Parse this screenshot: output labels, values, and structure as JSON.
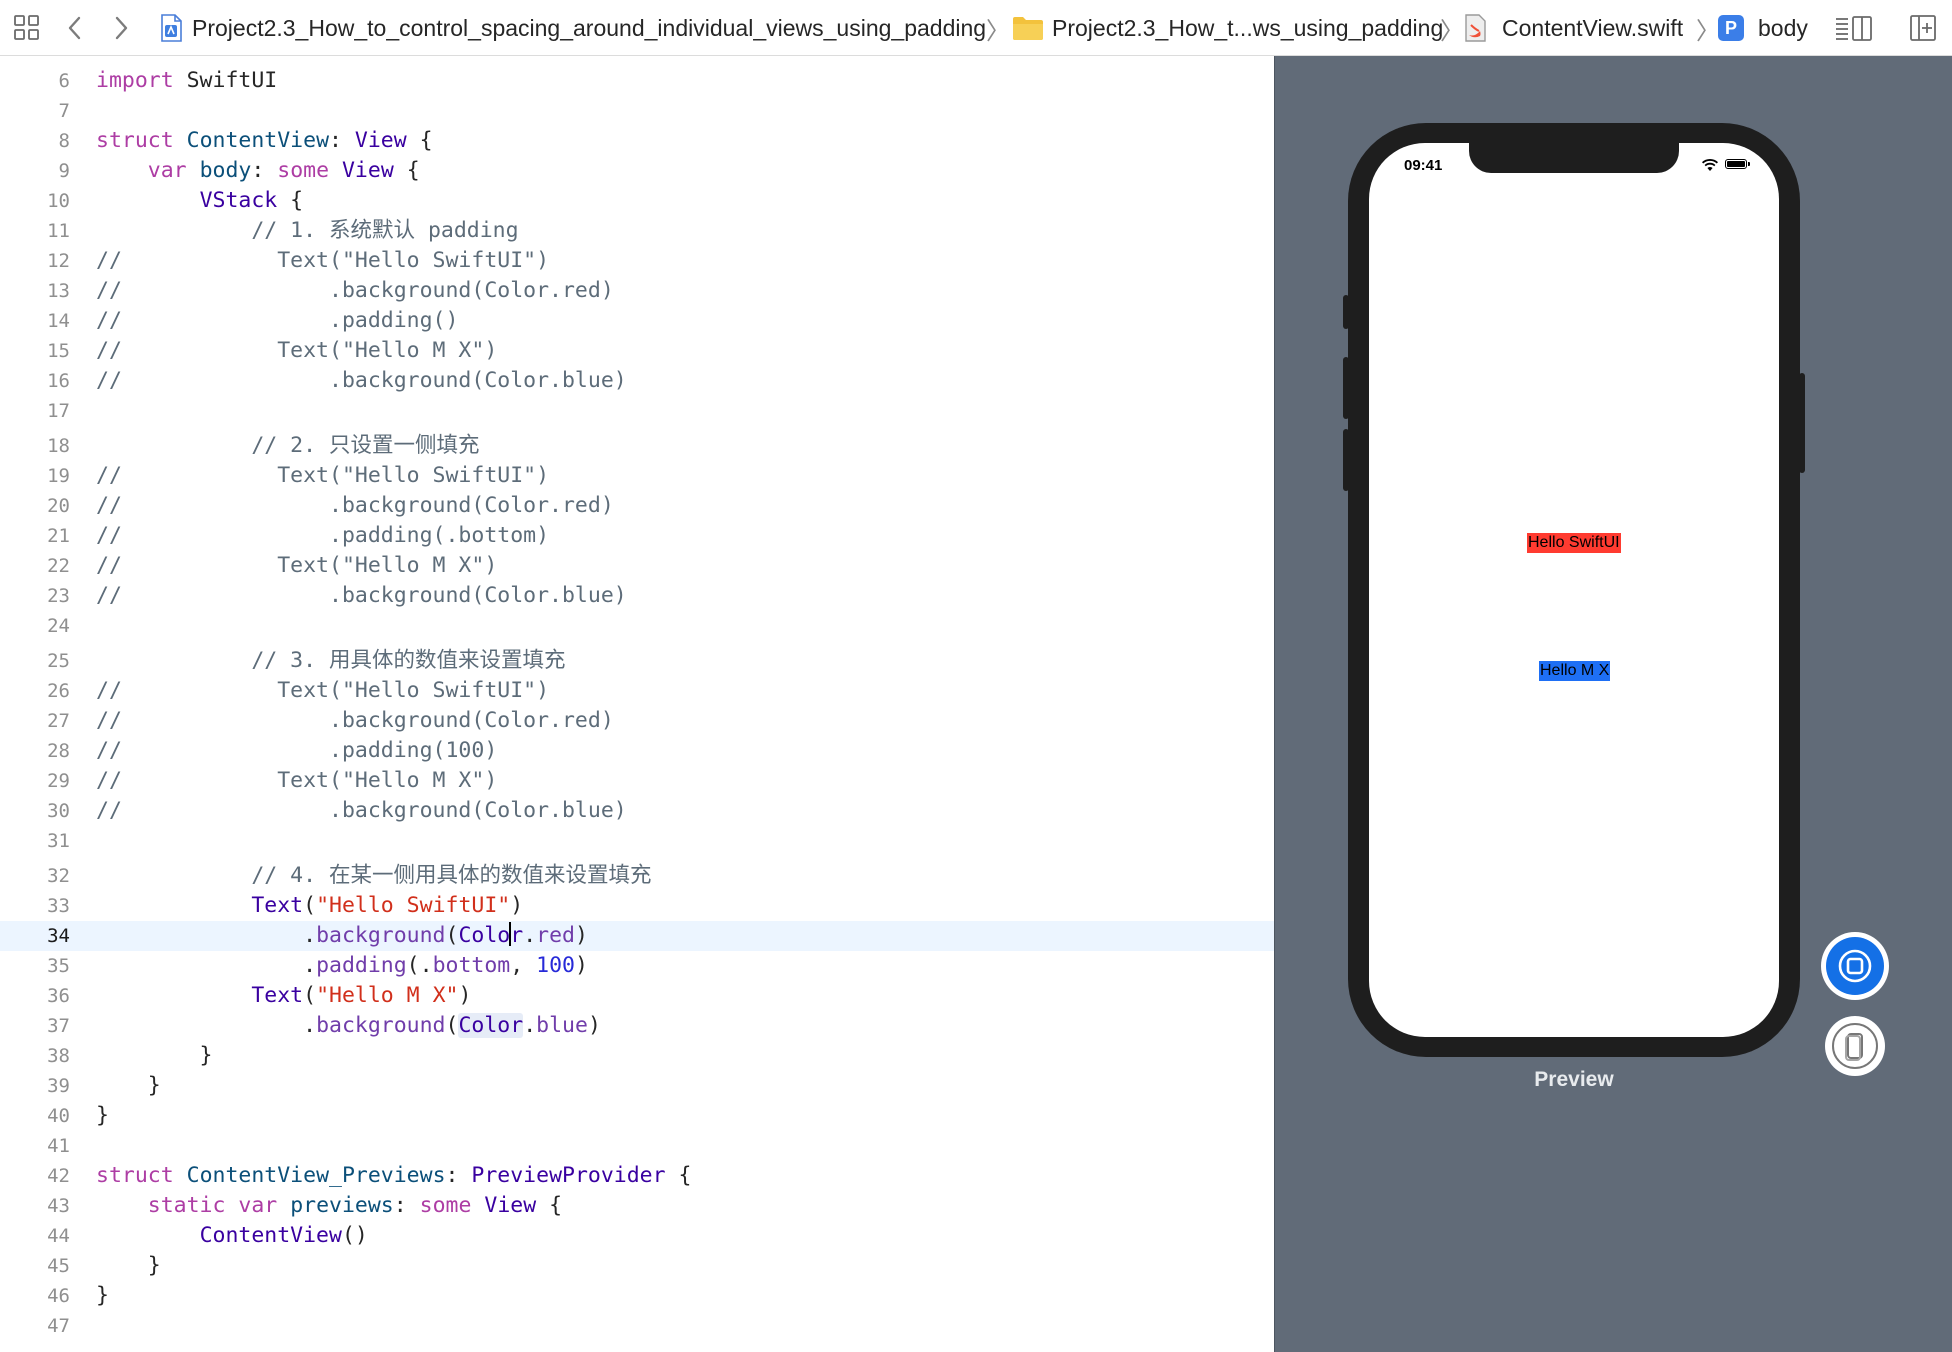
{
  "jumpbar": {
    "breadcrumbs": [
      {
        "label": "Project2.3_How_to_control_spacing_around_individual_views_using_padding",
        "icon": "xcode-project-icon"
      },
      {
        "label": "Project2.3_How_t...ws_using_padding",
        "icon": "folder-icon"
      },
      {
        "label": "ContentView.swift",
        "icon": "swift-file-icon"
      },
      {
        "label": "body",
        "icon": "property-icon",
        "badge": "P"
      }
    ],
    "icons": [
      "grid-icon",
      "back-arrow-icon",
      "forward-arrow-icon",
      "editor-options-icon",
      "add-editor-icon"
    ],
    "separator": "〉"
  },
  "editor": {
    "current_line": 34,
    "lines": [
      {
        "n": "6",
        "text": "import SwiftUI"
      },
      {
        "n": "7",
        "text": ""
      },
      {
        "n": "8",
        "text": "struct ContentView: View {"
      },
      {
        "n": "9",
        "text": "    var body: some View {"
      },
      {
        "n": "10",
        "text": "        VStack {"
      },
      {
        "n": "11",
        "text": "            // 1. 系统默认 padding"
      },
      {
        "n": "12",
        "text": "//            Text(\"Hello SwiftUI\")"
      },
      {
        "n": "13",
        "text": "//                .background(Color.red)"
      },
      {
        "n": "14",
        "text": "//                .padding()"
      },
      {
        "n": "15",
        "text": "//            Text(\"Hello M X\")"
      },
      {
        "n": "16",
        "text": "//                .background(Color.blue)"
      },
      {
        "n": "17",
        "text": ""
      },
      {
        "n": "18",
        "text": "            // 2. 只设置一侧填充"
      },
      {
        "n": "19",
        "text": "//            Text(\"Hello SwiftUI\")"
      },
      {
        "n": "20",
        "text": "//                .background(Color.red)"
      },
      {
        "n": "21",
        "text": "//                .padding(.bottom)"
      },
      {
        "n": "22",
        "text": "//            Text(\"Hello M X\")"
      },
      {
        "n": "23",
        "text": "//                .background(Color.blue)"
      },
      {
        "n": "24",
        "text": ""
      },
      {
        "n": "25",
        "text": "            // 3. 用具体的数值来设置填充"
      },
      {
        "n": "26",
        "text": "//            Text(\"Hello SwiftUI\")"
      },
      {
        "n": "27",
        "text": "//                .background(Color.red)"
      },
      {
        "n": "28",
        "text": "//                .padding(100)"
      },
      {
        "n": "29",
        "text": "//            Text(\"Hello M X\")"
      },
      {
        "n": "30",
        "text": "//                .background(Color.blue)"
      },
      {
        "n": "31",
        "text": ""
      },
      {
        "n": "32",
        "text": "            // 4. 在某一侧用具体的数值来设置填充"
      },
      {
        "n": "33",
        "text": "            Text(\"Hello SwiftUI\")"
      },
      {
        "n": "34",
        "text": "                .background(Color.red)"
      },
      {
        "n": "35",
        "text": "                .padding(.bottom, 100)"
      },
      {
        "n": "36",
        "text": "            Text(\"Hello M X\")"
      },
      {
        "n": "37",
        "text": "                .background(Color.blue)"
      },
      {
        "n": "38",
        "text": "        }"
      },
      {
        "n": "39",
        "text": "    }"
      },
      {
        "n": "40",
        "text": "}"
      },
      {
        "n": "41",
        "text": ""
      },
      {
        "n": "42",
        "text": "struct ContentView_Previews: PreviewProvider {"
      },
      {
        "n": "43",
        "text": "    static var previews: some View {"
      },
      {
        "n": "44",
        "text": "        ContentView()"
      },
      {
        "n": "45",
        "text": "    }"
      },
      {
        "n": "46",
        "text": "}"
      },
      {
        "n": "47",
        "text": ""
      }
    ]
  },
  "preview": {
    "label": "Preview",
    "status_time": "09:41",
    "texts": [
      {
        "label": "Hello SwiftUI",
        "background": "#ff3b30"
      },
      {
        "label": "Hello M X",
        "background": "#1e6ff5"
      }
    ],
    "buttons": [
      "live-preview-icon",
      "preview-on-device-icon"
    ]
  },
  "colors": {
    "preview_background": "#616b78",
    "current_line": "#ecf5ff",
    "keyword": "#ad3da4",
    "type": "#3900a0",
    "declaration": "#0b4f79",
    "string": "#d12f1b",
    "number": "#272ad8",
    "property": "#703daa",
    "comment": "#5d6c79",
    "accent": "#1470e6"
  }
}
